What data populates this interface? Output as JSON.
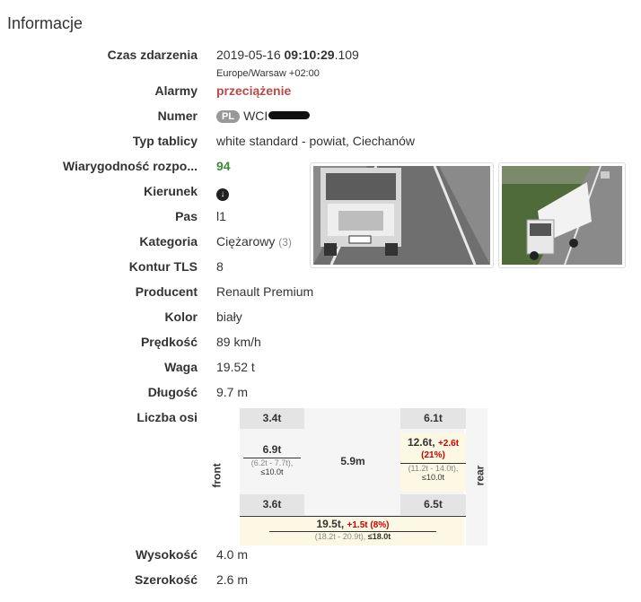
{
  "section_title": "Informacje",
  "event_time": {
    "label": "Czas zdarzenia",
    "date": "2019-05-16",
    "time_bold": "09:10:29",
    "ms": ".109",
    "timezone": "Europe/Warsaw +02:00"
  },
  "alarms": {
    "label": "Alarmy",
    "value": "przeciążenie"
  },
  "number": {
    "label": "Numer",
    "country": "PL",
    "plate_prefix": "WCI"
  },
  "plate_type": {
    "label": "Typ tablicy",
    "value": "white standard - powiat, Ciechanów"
  },
  "confidence": {
    "label": "Wiarygodność rozpo...",
    "value": "94"
  },
  "direction": {
    "label": "Kierunek",
    "icon": "arrow-down-circle-icon"
  },
  "lane": {
    "label": "Pas",
    "value": "l1"
  },
  "category": {
    "label": "Kategoria",
    "value": "Ciężarowy",
    "code": "(3)"
  },
  "tls": {
    "label": "Kontur TLS",
    "value": "8"
  },
  "producer": {
    "label": "Producent",
    "value": "Renault Premium"
  },
  "color": {
    "label": "Kolor",
    "value": "biały"
  },
  "speed": {
    "label": "Prędkość",
    "value": "89 km/h"
  },
  "weight": {
    "label": "Waga",
    "value": "19.52 t"
  },
  "length": {
    "label": "Długość",
    "value": "9.7 m"
  },
  "axles": {
    "label": "Liczba osi",
    "front_label": "front",
    "rear_label": "rear",
    "wheelbase": "5.9m",
    "front_left": "3.4t",
    "front_right": "3.6t",
    "rear_left": "6.1t",
    "rear_right": "6.5t",
    "front_axle": {
      "load": "6.9t",
      "range": "(6.2t - 7.7t),",
      "limit": "≤10.0t"
    },
    "rear_axle": {
      "load": "12.6t,",
      "over": "+2.6t",
      "over_pct": "(21%)",
      "range": "(11.2t - 14.0t),",
      "limit": "≤10.0t"
    },
    "total": {
      "load": "19.5t,",
      "over": "+1.5t (8%)",
      "range": "(18.2t - 20.9t),",
      "limit": "≤18.0t"
    }
  },
  "height": {
    "label": "Wysokość",
    "value": "4.0 m"
  },
  "width": {
    "label": "Szerokość",
    "value": "2.6 m"
  }
}
